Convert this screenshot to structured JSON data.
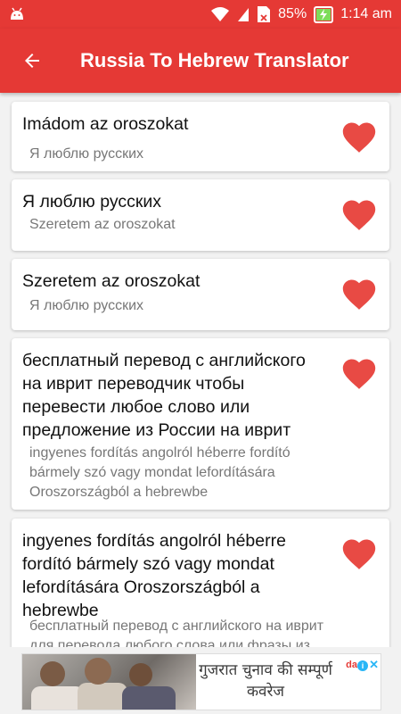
{
  "status_bar": {
    "battery_percent": "85%",
    "time": "1:14 am"
  },
  "app_bar": {
    "title": "Russia To Hebrew Translator"
  },
  "colors": {
    "primary": "#e53935",
    "heart": "#e84a44",
    "secondary_text": "#777777"
  },
  "items": [
    {
      "primary": "Imádom az oroszokat",
      "secondary": "Я люблю русских"
    },
    {
      "primary": "Я люблю русских",
      "secondary": "Szeretem az oroszokat"
    },
    {
      "primary": "Szeretem az oroszokat",
      "secondary": "Я люблю русских"
    },
    {
      "primary": "бесплатный перевод с английского на иврит переводчик чтобы перевести любое слово или предложение из России на иврит",
      "secondary": "ingyenes fordítás angolról héberre fordító bármely szó vagy mondat lefordítására Oroszországból a hebrewbe"
    },
    {
      "primary": "ingyenes fordítás angolról héberre fordító bármely szó vagy mondat lefordítására Oroszországból a hebrewbe",
      "secondary": "бесплатный перевод с английского на иврит для перевода любого слова или фразы из"
    }
  ],
  "ad": {
    "headline": "गुजरात चुनाव की सम्पूर्ण कवरेज",
    "brand": "da",
    "info_label": "i",
    "close_label": "✕"
  }
}
